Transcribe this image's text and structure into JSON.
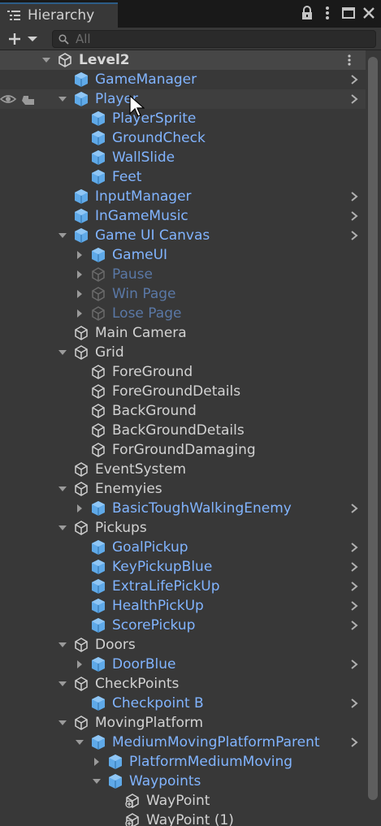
{
  "panel": {
    "title": "Hierarchy",
    "search_placeholder": "All"
  },
  "scene": {
    "name": "Level2"
  },
  "items": [
    {
      "label": "GameManager",
      "type": "prefab",
      "depth": 0,
      "expander": "none",
      "chevron": true
    },
    {
      "label": "Player",
      "type": "prefab",
      "depth": 0,
      "expander": "expanded",
      "chevron": true,
      "highlight": true
    },
    {
      "label": "PlayerSprite",
      "type": "prefab",
      "depth": 1,
      "expander": "none",
      "chevron": false
    },
    {
      "label": "GroundCheck",
      "type": "prefab",
      "depth": 1,
      "expander": "none",
      "chevron": false
    },
    {
      "label": "WallSlide",
      "type": "prefab",
      "depth": 1,
      "expander": "none",
      "chevron": false
    },
    {
      "label": "Feet",
      "type": "prefab",
      "depth": 1,
      "expander": "none",
      "chevron": false
    },
    {
      "label": "InputManager",
      "type": "prefab",
      "depth": 0,
      "expander": "none",
      "chevron": true
    },
    {
      "label": "InGameMusic",
      "type": "prefab",
      "depth": 0,
      "expander": "none",
      "chevron": true
    },
    {
      "label": "Game UI Canvas",
      "type": "prefab",
      "depth": 0,
      "expander": "expanded",
      "chevron": true
    },
    {
      "label": "GameUI",
      "type": "prefab",
      "depth": 1,
      "expander": "collapsed",
      "chevron": false
    },
    {
      "label": "Pause",
      "type": "inactive",
      "depth": 1,
      "expander": "collapsed",
      "chevron": false
    },
    {
      "label": "Win Page",
      "type": "inactive",
      "depth": 1,
      "expander": "collapsed",
      "chevron": false
    },
    {
      "label": "Lose Page",
      "type": "inactive",
      "depth": 1,
      "expander": "collapsed",
      "chevron": false
    },
    {
      "label": "Main Camera",
      "type": "plain",
      "depth": 0,
      "expander": "none",
      "chevron": false
    },
    {
      "label": "Grid",
      "type": "plain",
      "depth": 0,
      "expander": "expanded",
      "chevron": false
    },
    {
      "label": "ForeGround",
      "type": "plain",
      "depth": 1,
      "expander": "none",
      "chevron": false
    },
    {
      "label": "ForeGroundDetails",
      "type": "plain",
      "depth": 1,
      "expander": "none",
      "chevron": false
    },
    {
      "label": "BackGround",
      "type": "plain",
      "depth": 1,
      "expander": "none",
      "chevron": false
    },
    {
      "label": "BackGroundDetails",
      "type": "plain",
      "depth": 1,
      "expander": "none",
      "chevron": false
    },
    {
      "label": "ForGroundDamaging",
      "type": "plain",
      "depth": 1,
      "expander": "none",
      "chevron": false
    },
    {
      "label": "EventSystem",
      "type": "plain",
      "depth": 0,
      "expander": "none",
      "chevron": false
    },
    {
      "label": "Enemyies",
      "type": "plain",
      "depth": 0,
      "expander": "expanded",
      "chevron": false
    },
    {
      "label": "BasicToughWalkingEnemy",
      "type": "prefab-root",
      "depth": 1,
      "expander": "collapsed",
      "chevron": true
    },
    {
      "label": "Pickups",
      "type": "plain",
      "depth": 0,
      "expander": "expanded",
      "chevron": false
    },
    {
      "label": "GoalPickup",
      "type": "prefab-root",
      "depth": 1,
      "expander": "none",
      "chevron": true
    },
    {
      "label": "KeyPickupBlue",
      "type": "prefab-root",
      "depth": 1,
      "expander": "none",
      "chevron": true
    },
    {
      "label": "ExtraLifePickUp",
      "type": "prefab-root",
      "depth": 1,
      "expander": "none",
      "chevron": true
    },
    {
      "label": "HealthPickUp",
      "type": "prefab-root",
      "depth": 1,
      "expander": "none",
      "chevron": true
    },
    {
      "label": "ScorePickup",
      "type": "prefab-root",
      "depth": 1,
      "expander": "none",
      "chevron": true
    },
    {
      "label": "Doors",
      "type": "plain",
      "depth": 0,
      "expander": "expanded",
      "chevron": false
    },
    {
      "label": "DoorBlue",
      "type": "prefab-root",
      "depth": 1,
      "expander": "collapsed",
      "chevron": true
    },
    {
      "label": "CheckPoints",
      "type": "plain",
      "depth": 0,
      "expander": "expanded",
      "chevron": false
    },
    {
      "label": "Checkpoint B",
      "type": "prefab-root",
      "depth": 1,
      "expander": "none",
      "chevron": true
    },
    {
      "label": "MovingPlatform",
      "type": "plain",
      "depth": 0,
      "expander": "expanded",
      "chevron": false
    },
    {
      "label": "MediumMovingPlatformParent",
      "type": "prefab-root",
      "depth": 1,
      "expander": "expanded",
      "chevron": true
    },
    {
      "label": "PlatformMediumMoving",
      "type": "prefab",
      "depth": 2,
      "expander": "collapsed",
      "chevron": false
    },
    {
      "label": "Waypoints",
      "type": "prefab",
      "depth": 2,
      "expander": "expanded",
      "chevron": false
    },
    {
      "label": "WayPoint",
      "type": "plain-added",
      "depth": 3,
      "expander": "none",
      "chevron": false
    },
    {
      "label": "WayPoint (1)",
      "type": "plain-added",
      "depth": 3,
      "expander": "none",
      "chevron": false
    }
  ],
  "colors": {
    "prefab_text": "#81b4ff",
    "plain_text": "#d2d2d2",
    "inactive_text": "#5a78a6",
    "panel_bg": "#383838"
  }
}
